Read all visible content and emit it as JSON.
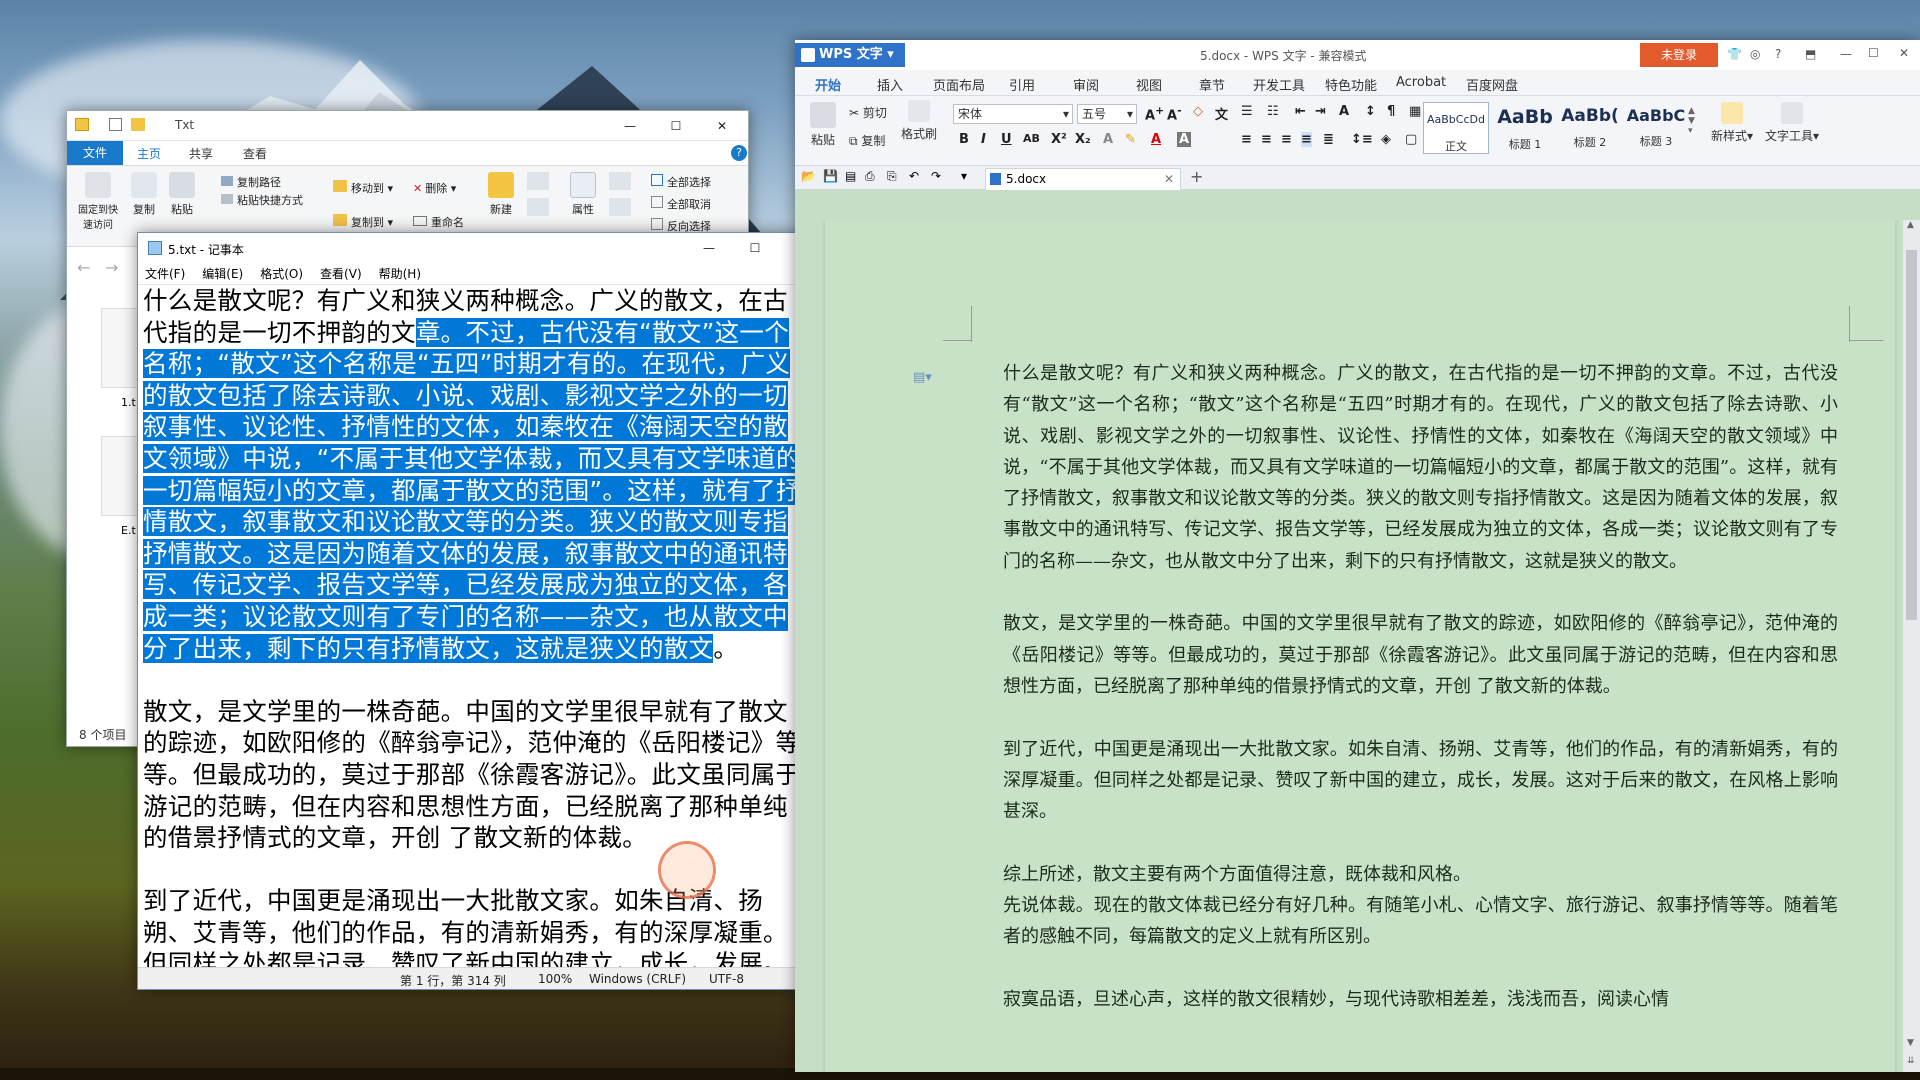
{
  "explorer": {
    "title": "Txt",
    "tabs": [
      "文件",
      "主页",
      "共享",
      "查看"
    ],
    "ribbon": {
      "pin": "固定到快\n速访问",
      "copy": "复制",
      "paste": "粘贴",
      "copy_path": "复制路径",
      "paste_shortcut": "粘贴快捷方式",
      "move_to": "移动到",
      "delete": "删除",
      "copy_to": "复制到",
      "rename": "重命名",
      "new": "新建",
      "properties": "属性",
      "select_all": "全部选择",
      "select_none": "全部取消",
      "invert": "反向选择"
    },
    "files": [
      "1.t",
      "E.t"
    ],
    "status": "8 个项目"
  },
  "notepad": {
    "title": "5.txt - 记事本",
    "menu": [
      "文件(F)",
      "编辑(E)",
      "格式(O)",
      "查看(V)",
      "帮助(H)"
    ],
    "para1_pre": "什么是散文呢？有广义和狭义两种概念。广义的散文，在古代指的是一切不押韵的文",
    "para1_sel": "章。不过，古代没有“散文”这一个名称；“散文”这个名称是“五四”时期才有的。在现代，广义的散文包括了除去诗歌、小说、戏剧、影视文学之外的一切叙事性、议论性、抒情性的文体，如秦牧在《海阔天空的散文领域》中说，“不属于其他文学体裁，而又具有文学味道的一切篇幅短小的文章，都属于散文的范围”。这样，就有了抒情散文，叙事散文和议论散文等的分类。狭义的散文则专指抒情散文。这是因为随着文体的发展，叙事散文中的通讯特写、传记文学、报告文学等，已经发展成为独立的文体，各成一类；议论散文则有了专门的名称——杂文，也从散文中分了出来，剩下的只有抒情散文，这就是狭义的散文",
    "para1_post": "。",
    "para2": "散文，是文学里的一株奇葩。中国的文学里很早就有了散文的踪迹，如欧阳修的《醉翁亭记》，范仲淹的《岳阳楼记》等等。但最成功的，莫过于那部《徐霞客游记》。此文虽同属于游记的范畴，但在内容和思想性方面，已经脱离了那种单纯的借景抒情式的文章，开创 了散文新的体裁。",
    "para3": "到了近代，中国更是涌现出一大批散文家。如朱自清、扬朔、艾青等，他们的作品，有的清新娟秀，有的深厚凝重。但同样之处都是记录、赞叹了新中国的建立，成长，发展。这对于后",
    "status": {
      "position": "第 1 行，第 314 列",
      "zoom": "100%",
      "eol": "Windows (CRLF)",
      "encoding": "UTF-8"
    }
  },
  "wps": {
    "app_label": "WPS 文字",
    "window_title": "5.docx - WPS 文字 - 兼容模式",
    "login": "未登录",
    "menus": [
      "开始",
      "插入",
      "页面布局",
      "引用",
      "审阅",
      "视图",
      "章节",
      "开发工具",
      "特色功能",
      "Acrobat",
      "百度网盘"
    ],
    "ribbon": {
      "paste": "粘贴",
      "cut": "剪切",
      "copy": "复制",
      "format_painter": "格式刷",
      "font": "宋体",
      "size": "五号",
      "styles": [
        {
          "sample": "AaBbCcDd",
          "name": "正文"
        },
        {
          "sample": "AaBb",
          "name": "标题 1"
        },
        {
          "sample": "AaBb(",
          "name": "标题 2"
        },
        {
          "sample": "AaBbC",
          "name": "标题 3"
        }
      ],
      "new_style": "新样式",
      "text_tools": "文字工具"
    },
    "doc_tab": "5.docx",
    "doc": {
      "p1": "什么是散文呢？有广义和狭义两种概念。广义的散文，在古代指的是一切不押韵的文章。不过，古代没有“散文”这一个名称；“散文”这个名称是“五四”时期才有的。在现代，广义的散文包括了除去诗歌、小说、戏剧、影视文学之外的一切叙事性、议论性、抒情性的文体，如秦牧在《海阔天空的散文领域》中说，“不属于其他文学体裁，而又具有文学味道的一切篇幅短小的文章，都属于散文的范围”。这样，就有了抒情散文，叙事散文和议论散文等的分类。狭义的散文则专指抒情散文。这是因为随着文体的发展，叙事散文中的通讯特写、传记文学、报告文学等，已经发展成为独立的文体，各成一类；议论散文则有了专门的名称——杂文，也从散文中分了出来，剩下的只有抒情散文，这就是狭义的散文。",
      "p2": "散文，是文学里的一株奇葩。中国的文学里很早就有了散文的踪迹，如欧阳修的《醉翁亭记》，范仲淹的《岳阳楼记》等等。但最成功的，莫过于那部《徐霞客游记》。此文虽同属于游记的范畴，但在内容和思想性方面，已经脱离了那种单纯的借景抒情式的文章，开创 了散文新的体裁。",
      "p3": "到了近代，中国更是涌现出一大批散文家。如朱自清、扬朔、艾青等，他们的作品，有的清新娟秀，有的深厚凝重。但同样之处都是记录、赞叹了新中国的建立，成长，发展。这对于后来的散文，在风格上影响甚深。",
      "p4": "综上所述，散文主要有两个方面值得注意，既体裁和风格。",
      "p5": "先说体裁。现在的散文体裁已经分有好几种。有随笔小札、心情文字、旅行游记、叙事抒情等等。随着笔者的感触不同，每篇散文的定义上就有所区别。",
      "p6": "寂寞品语，旦述心声，这样的散文很精妙，与现代诗歌相差差，浅浅而吾，阅读心情"
    }
  },
  "colors": {
    "selection": "#0078d7",
    "wps_bg": "#c6dec5",
    "wps_login": "#e35a2c",
    "explorer_file_tab": "#1979ca"
  }
}
